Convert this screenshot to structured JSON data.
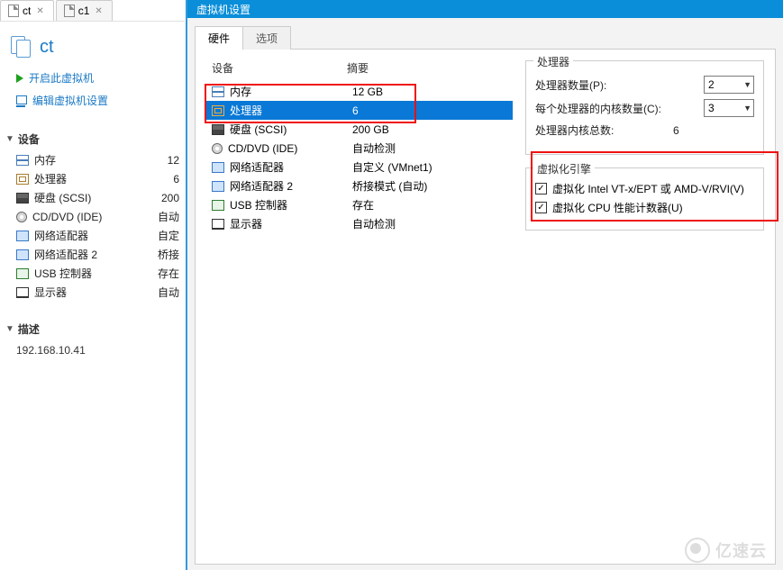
{
  "tabs": [
    {
      "label": "ct",
      "active": true
    },
    {
      "label": "c1",
      "active": false
    }
  ],
  "vm": {
    "title": "ct",
    "actions": {
      "start": "开启此虚拟机",
      "edit": "编辑虚拟机设置"
    }
  },
  "left": {
    "devices_header": "设备",
    "devices": [
      {
        "icon": "mem",
        "label": "内存",
        "value": "12"
      },
      {
        "icon": "cpu",
        "label": "处理器",
        "value": "6"
      },
      {
        "icon": "hd",
        "label": "硬盘 (SCSI)",
        "value": "200"
      },
      {
        "icon": "cd",
        "label": "CD/DVD (IDE)",
        "value": "自动"
      },
      {
        "icon": "net",
        "label": "网络适配器",
        "value": "自定"
      },
      {
        "icon": "net",
        "label": "网络适配器 2",
        "value": "桥接"
      },
      {
        "icon": "usb",
        "label": "USB 控制器",
        "value": "存在"
      },
      {
        "icon": "disp",
        "label": "显示器",
        "value": "自动"
      }
    ],
    "desc_header": "描述",
    "desc_text": "192.168.10.41"
  },
  "dialog": {
    "title": "虚拟机设置",
    "tabs": {
      "hardware": "硬件",
      "options": "选项"
    },
    "col_device": "设备",
    "col_summary": "摘要",
    "rows": [
      {
        "icon": "mem",
        "label": "内存",
        "summary": "12 GB",
        "selected": false
      },
      {
        "icon": "cpu",
        "label": "处理器",
        "summary": "6",
        "selected": true
      },
      {
        "icon": "hd",
        "label": "硬盘 (SCSI)",
        "summary": "200 GB",
        "selected": false
      },
      {
        "icon": "cd",
        "label": "CD/DVD (IDE)",
        "summary": "自动检测",
        "selected": false
      },
      {
        "icon": "net",
        "label": "网络适配器",
        "summary": "自定义 (VMnet1)",
        "selected": false
      },
      {
        "icon": "net",
        "label": "网络适配器 2",
        "summary": "桥接模式 (自动)",
        "selected": false
      },
      {
        "icon": "usb",
        "label": "USB 控制器",
        "summary": "存在",
        "selected": false
      },
      {
        "icon": "disp",
        "label": "显示器",
        "summary": "自动检测",
        "selected": false
      }
    ],
    "proc_group": {
      "title": "处理器",
      "count_label": "处理器数量(P):",
      "count_value": "2",
      "cores_label": "每个处理器的内核数量(C):",
      "cores_value": "3",
      "total_label": "处理器内核总数:",
      "total_value": "6"
    },
    "virt_group": {
      "title": "虚拟化引擎",
      "vt_label": "虚拟化 Intel VT-x/EPT 或 AMD-V/RVI(V)",
      "perf_label": "虚拟化 CPU 性能计数器(U)"
    }
  },
  "watermark": "亿速云"
}
